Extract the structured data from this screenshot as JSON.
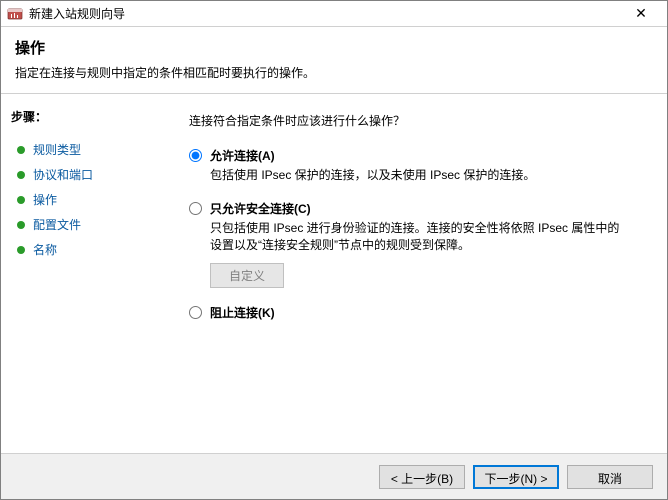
{
  "titlebar": {
    "title": "新建入站规则向导",
    "close": "✕"
  },
  "header": {
    "heading": "操作",
    "subheading": "指定在连接与规则中指定的条件相匹配时要执行的操作。"
  },
  "sidebar": {
    "steps_label": "步骤：",
    "items": [
      {
        "label": "规则类型"
      },
      {
        "label": "协议和端口"
      },
      {
        "label": "操作"
      },
      {
        "label": "配置文件"
      },
      {
        "label": "名称"
      }
    ]
  },
  "content": {
    "question": "连接符合指定条件时应该进行什么操作？",
    "options": [
      {
        "id": "allow",
        "label": "允许连接(A)",
        "desc": "包括使用 IPsec 保护的连接，以及未使用 IPsec 保护的连接。"
      },
      {
        "id": "secure",
        "label": "只允许安全连接(C)",
        "desc": "只包括使用 IPsec 进行身份验证的连接。连接的安全性将依照 IPsec 属性中的设置以及“连接安全规则”节点中的规则受到保障。"
      },
      {
        "id": "block",
        "label": "阻止连接(K)",
        "desc": ""
      }
    ],
    "customize_label": "自定义"
  },
  "footer": {
    "back": "< 上一步(B)",
    "next": "下一步(N) >",
    "cancel": "取消"
  }
}
